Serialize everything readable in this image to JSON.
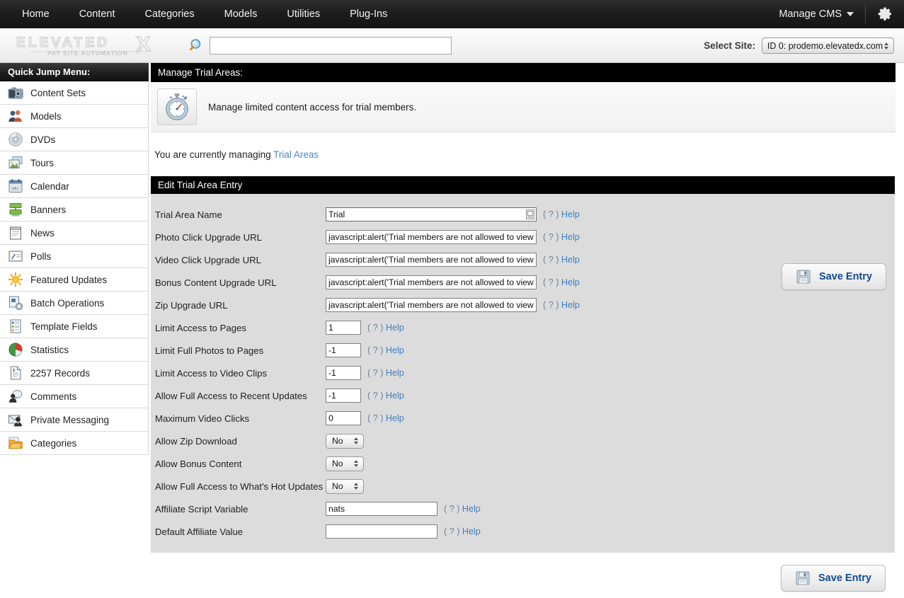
{
  "topnav": {
    "items": [
      {
        "label": "Home"
      },
      {
        "label": "Content"
      },
      {
        "label": "Categories"
      },
      {
        "label": "Models"
      },
      {
        "label": "Utilities"
      },
      {
        "label": "Plug-Ins"
      }
    ],
    "manage_cms": "Manage CMS",
    "gear_icon": "gear-icon"
  },
  "brandbar": {
    "logo_text": "ELEVATEDX",
    "logo_tagline": "PAY SITE AUTOMATION",
    "search_icon": "search-icon",
    "search_value": "",
    "search_placeholder": "",
    "site_label": "Select Site:",
    "site_value": "ID 0: prodemo.elevatedx.com"
  },
  "sidebar": {
    "header": "Quick Jump Menu:",
    "items": [
      {
        "label": "Content Sets",
        "icon": "camera-icon"
      },
      {
        "label": "Models",
        "icon": "people-icon"
      },
      {
        "label": "DVDs",
        "icon": "disc-icon"
      },
      {
        "label": "Tours",
        "icon": "photos-icon"
      },
      {
        "label": "Calendar",
        "icon": "calendar-icon"
      },
      {
        "label": "Banners",
        "icon": "banner-icon"
      },
      {
        "label": "News",
        "icon": "notepad-icon"
      },
      {
        "label": "Polls",
        "icon": "poll-icon"
      },
      {
        "label": "Featured Updates",
        "icon": "sun-icon"
      },
      {
        "label": "Batch Operations",
        "icon": "batch-gear-icon"
      },
      {
        "label": "Template Fields",
        "icon": "document-list-icon"
      },
      {
        "label": "Statistics",
        "icon": "pie-chart-icon"
      },
      {
        "label": "2257 Records",
        "icon": "record-document-icon"
      },
      {
        "label": "Comments",
        "icon": "comment-icon"
      },
      {
        "label": "Private Messaging",
        "icon": "envelope-person-icon"
      },
      {
        "label": "Categories",
        "icon": "folder-icon"
      }
    ]
  },
  "main": {
    "page_header": "Manage Trial Areas:",
    "page_icon": "stopwatch-icon",
    "page_description": "Manage limited content access for trial members.",
    "managing_prefix": "You are currently managing",
    "managing_link": "Trial Areas",
    "save_label": "Save Entry",
    "save_icon": "floppy-disk-icon",
    "form_title": "Edit Trial Area Entry",
    "help_paren_open": "( ? )",
    "help_word": "Help",
    "fields": [
      {
        "label": "Trial Area Name",
        "type": "text-name",
        "value": "Trial",
        "help": true
      },
      {
        "label": "Photo Click Upgrade URL",
        "type": "text-url",
        "value": "javascript:alert('Trial members are not allowed to view",
        "help": true
      },
      {
        "label": "Video Click Upgrade URL",
        "type": "text-url",
        "value": "javascript:alert('Trial members are not allowed to view",
        "help": true
      },
      {
        "label": "Bonus Content Upgrade URL",
        "type": "text-url",
        "value": "javascript:alert('Trial members are not allowed to view",
        "help": true
      },
      {
        "label": "Zip Upgrade URL",
        "type": "text-url",
        "value": "javascript:alert('Trial members are not allowed to view",
        "help": true
      },
      {
        "label": "Limit Access to Pages",
        "type": "text-num",
        "value": "1",
        "help": true
      },
      {
        "label": "Limit Full Photos to Pages",
        "type": "text-num",
        "value": "-1",
        "help": true
      },
      {
        "label": "Limit Access to Video Clips",
        "type": "text-num",
        "value": "-1",
        "help": true
      },
      {
        "label": "Allow Full Access to Recent Updates",
        "type": "text-num",
        "value": "-1",
        "help": true
      },
      {
        "label": "Maximum Video Clicks",
        "type": "text-num",
        "value": "0",
        "help": true
      },
      {
        "label": "Allow Zip Download",
        "type": "select",
        "value": "No",
        "help": false
      },
      {
        "label": "Allow Bonus Content",
        "type": "select",
        "value": "No",
        "help": false
      },
      {
        "label": "Allow Full Access to What's Hot Updates",
        "type": "select",
        "value": "No",
        "help": false
      },
      {
        "label": "Affiliate Script Variable",
        "type": "text-aff",
        "value": "nats",
        "help": true
      },
      {
        "label": "Default Affiliate Value",
        "type": "text-aff",
        "value": "",
        "help": true
      }
    ]
  },
  "colors": {
    "nav_bg": "#1c1c1c",
    "panel_bg": "#dcdcdc",
    "link_blue": "#3f7fc4",
    "save_text_blue": "#0f4b8f",
    "managing_link": "#4f86c6"
  }
}
